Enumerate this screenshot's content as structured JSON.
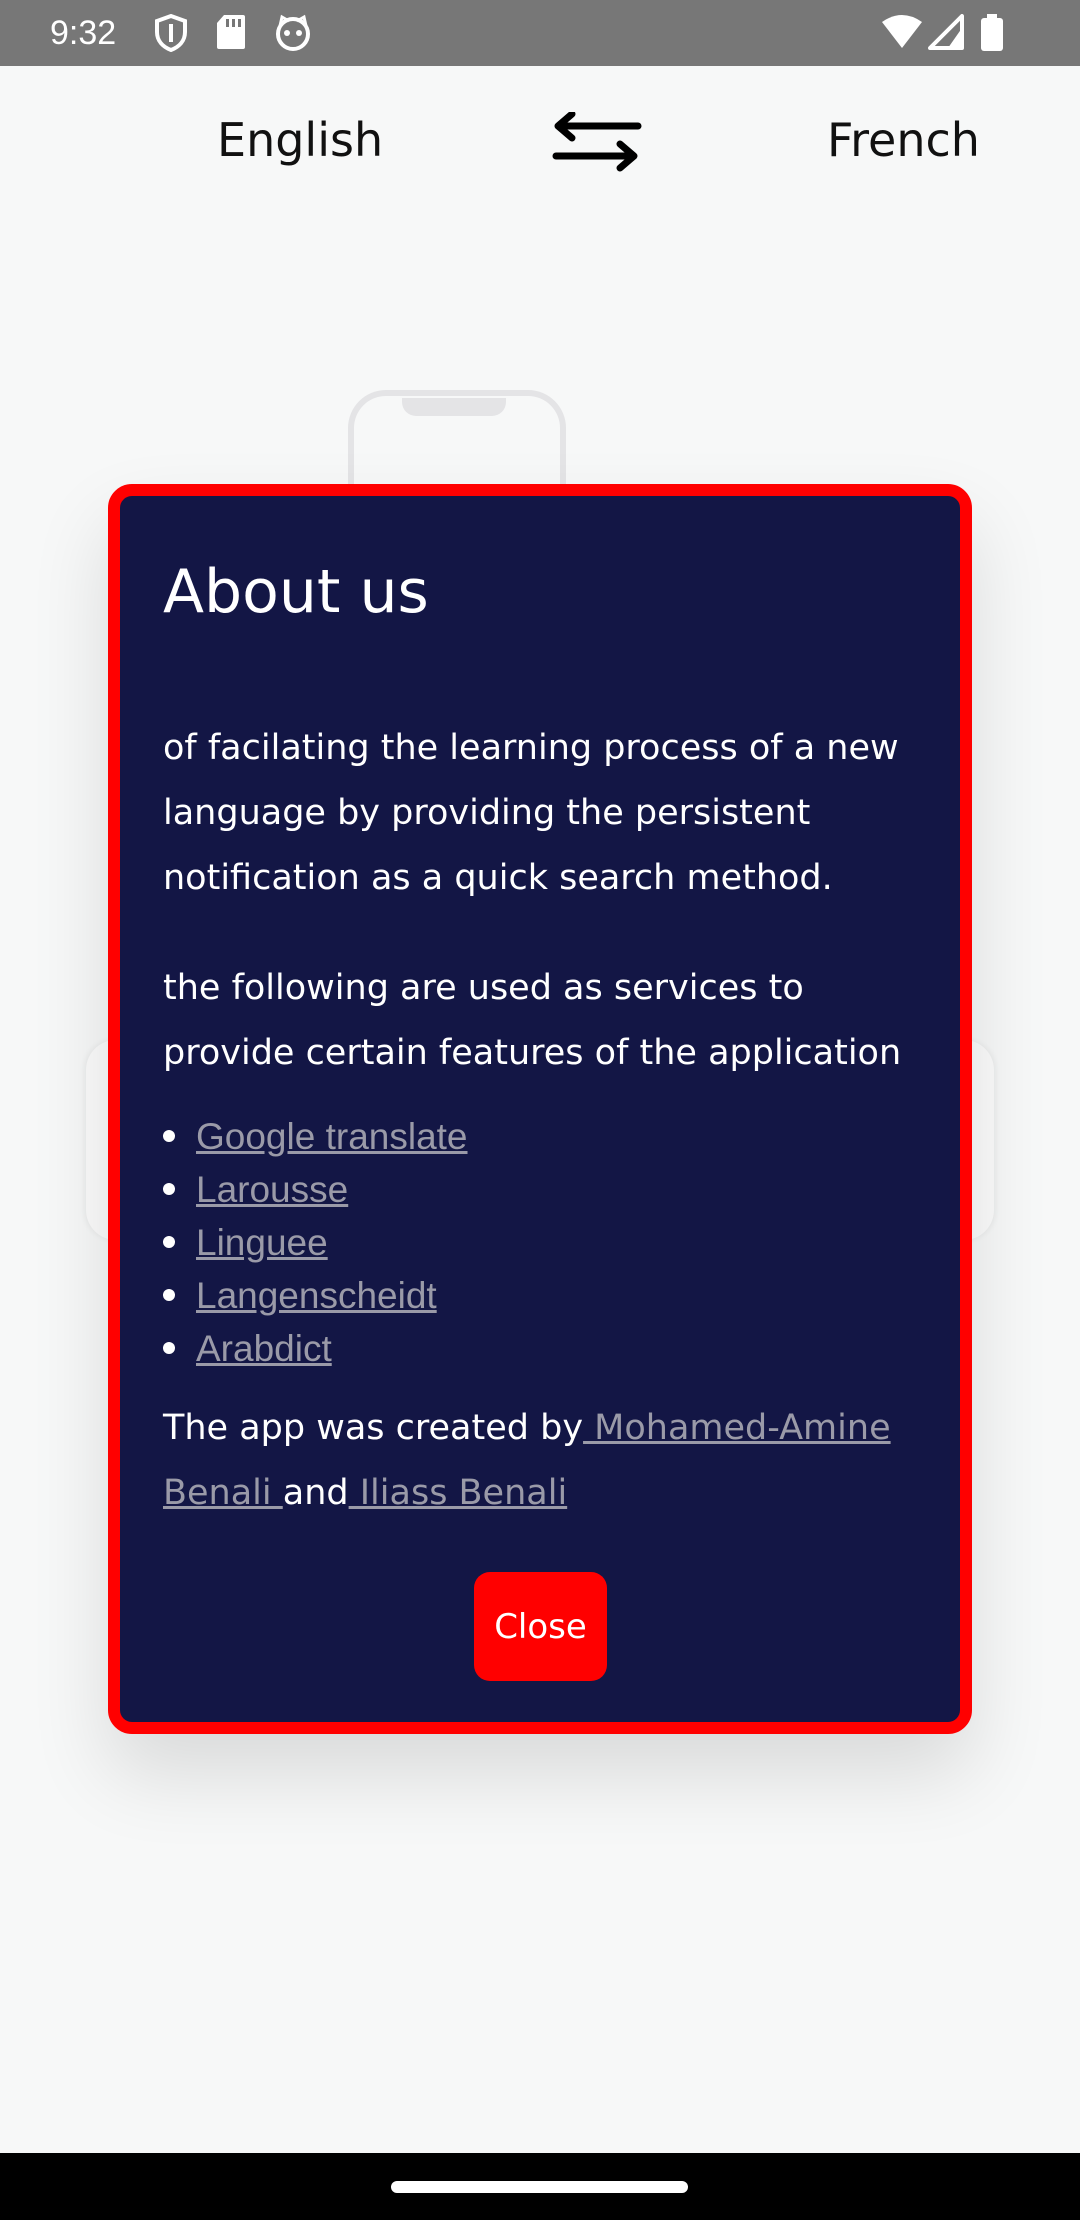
{
  "status_bar": {
    "time": "9:32",
    "left_icons": [
      "shield-icon",
      "sd-card-icon",
      "cat-face-icon"
    ],
    "right_icons": [
      "wifi-icon",
      "cellular-signal-icon",
      "battery-icon"
    ]
  },
  "header": {
    "source_language": "English",
    "target_language": "French",
    "swap_icon": "swap-arrows-icon"
  },
  "dialog": {
    "title": "About us",
    "paragraph_1": "of facilating the learning process of a new language by providing the persistent notification as a quick search method.",
    "paragraph_2": "the following are used as services to provide certain features of the application",
    "services": [
      {
        "label": "Google translate"
      },
      {
        "label": "Larousse"
      },
      {
        "label": "Linguee"
      },
      {
        "label": "Langenscheidt"
      },
      {
        "label": "Arabdict"
      }
    ],
    "credits": {
      "prefix": "The app was created by",
      "author_1": " Mohamed-Amine Benali ",
      "joiner": "and",
      "author_2": " Iliass Benali "
    },
    "close_label": "Close"
  },
  "colors": {
    "dialog_background": "#131645",
    "dialog_border": "#ff0000",
    "close_button": "#ff0000",
    "link": "#9a9aa8",
    "status_bar": "#777777"
  }
}
